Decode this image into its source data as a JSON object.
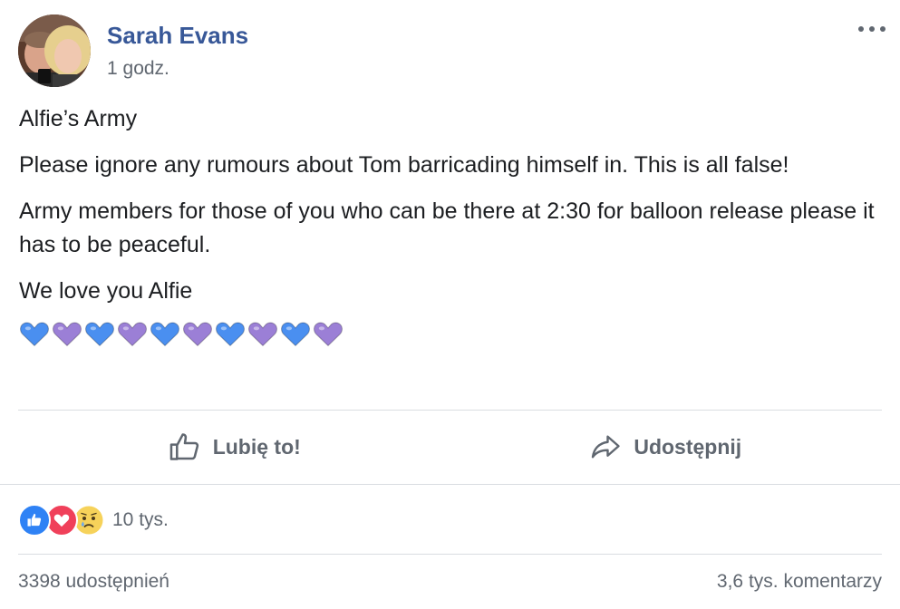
{
  "post": {
    "author": "Sarah Evans",
    "timestamp": "1 godz.",
    "more_icon": "ellipsis-icon",
    "paragraphs": [
      "Alfie’s Army",
      "Please ignore any rumours about Tom barricading himself in. This is all false!",
      "Army members for those of you who can be there at 2:30 for balloon release please it has to be peaceful.",
      "We love you Alfie"
    ],
    "hearts": [
      "blue",
      "purple",
      "blue",
      "purple",
      "blue",
      "purple",
      "blue",
      "purple",
      "blue",
      "purple"
    ],
    "heart_colors": {
      "blue": "#4a8ff0",
      "purple": "#9b7fd6"
    }
  },
  "actions": {
    "like_label": "Lubię to!",
    "like_icon": "thumbs-up-icon",
    "share_label": "Udostępnij",
    "share_icon": "share-arrow-icon"
  },
  "reactions": {
    "icons": [
      "like-reaction-icon",
      "love-reaction-icon",
      "sad-reaction-icon"
    ],
    "count": "10 tys."
  },
  "stats": {
    "shares": "3398 udostępnień",
    "comments": "3,6 tys. komentarzy"
  },
  "colors": {
    "author": "#385898",
    "secondary_text": "#606770",
    "divider": "#dadde1"
  }
}
